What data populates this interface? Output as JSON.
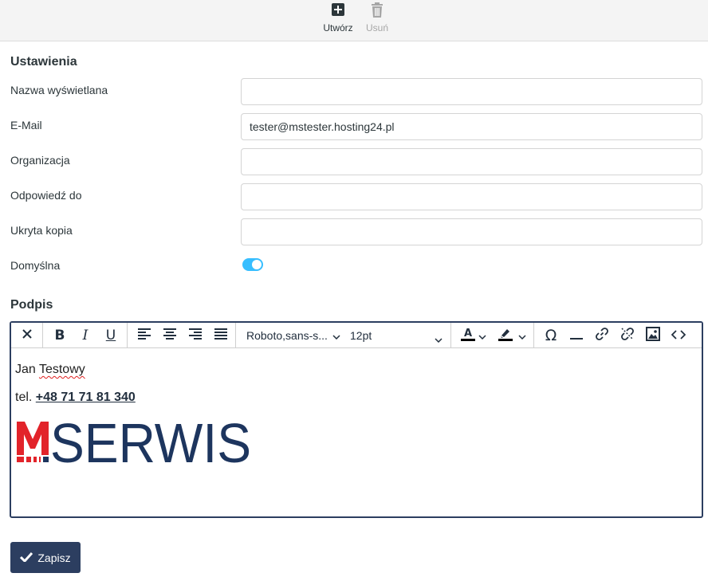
{
  "toolbar": {
    "create_label": "Utwórz",
    "delete_label": "Usuń"
  },
  "settings": {
    "title": "Ustawienia",
    "display_name": {
      "label": "Nazwa wyświetlana",
      "value": ""
    },
    "email": {
      "label": "E-Mail",
      "value": "tester@mstester.hosting24.pl"
    },
    "organization": {
      "label": "Organizacja",
      "value": ""
    },
    "reply_to": {
      "label": "Odpowiedź do",
      "value": ""
    },
    "bcc": {
      "label": "Ukryta kopia",
      "value": ""
    },
    "default": {
      "label": "Domyślna",
      "checked": true
    }
  },
  "signature": {
    "title": "Podpis",
    "font_family": "Roboto,sans-s...",
    "font_size": "12pt",
    "content": {
      "name_first": "Jan ",
      "name_last": "Testowy",
      "tel_prefix": "tel. ",
      "tel_number": "+48 71 71 81 340",
      "logo_text": "MSERWIS"
    }
  },
  "save_label": "Zapisz",
  "colors": {
    "accent": "#2c3e60",
    "toggle": "#37beff",
    "logo_red": "#e2232a",
    "logo_blue": "#1d355e"
  }
}
